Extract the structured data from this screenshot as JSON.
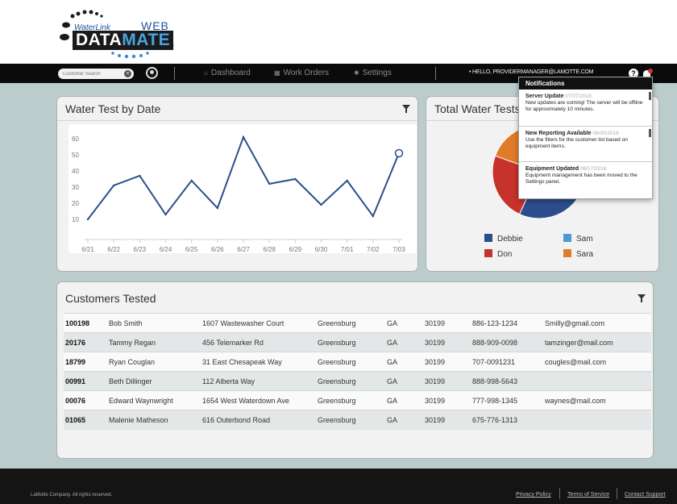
{
  "brand": {
    "top": "WaterLink",
    "web": "WEB",
    "name_a": "DATA",
    "name_b": "MATE"
  },
  "nav": {
    "search_placeholder": "Customer Search",
    "dashboard": "Dashboard",
    "work_orders": "Work Orders",
    "settings": "Settings",
    "hello": "• HELLO, PROVIDERMANAGER@LAMOTTE.COM",
    "help": "?"
  },
  "notifications": {
    "title": "Notifications",
    "items": [
      {
        "title": "Server Update",
        "date": "07/07/2016",
        "body": "New updates are coming! The server will be offline for approximately 10 minutes."
      },
      {
        "title": "New Reporting Available",
        "date": "06/30/2016",
        "body": "Use the filters for the customer list based on equipment items."
      },
      {
        "title": "Equipment Updated",
        "date": "06/17/2016",
        "body": "Equipment management has been moved to the Settings panel."
      }
    ]
  },
  "water_test": {
    "title": "Water Test by Date"
  },
  "chart_data": [
    {
      "type": "line",
      "title": "Water Test by Date",
      "categories": [
        "6/21",
        "6/22",
        "6/23",
        "6/24",
        "6/25",
        "6/26",
        "6/27",
        "6/28",
        "6/29",
        "6/30",
        "7/01",
        "7/02",
        "7/03"
      ],
      "values": [
        10,
        31,
        37,
        13,
        34,
        17,
        61,
        32,
        35,
        19,
        34,
        12,
        51
      ],
      "yticks": [
        10,
        20,
        30,
        40,
        50,
        60
      ],
      "ylim": [
        0,
        65
      ],
      "line_color": "#2b4f8a"
    },
    {
      "type": "pie",
      "title": "Total Water Tests",
      "legend": [
        {
          "name": "Debbie",
          "color": "#2c4d8c"
        },
        {
          "name": "Sam",
          "color": "#4a9bd4"
        },
        {
          "name": "Don",
          "color": "#c8322c"
        },
        {
          "name": "Sara",
          "color": "#e07b2a"
        }
      ]
    }
  ],
  "customers": {
    "title": "Customers Tested",
    "rows": [
      {
        "id": "100198",
        "name": "Bob Smith",
        "address": "1607 Wastewasher Court",
        "city": "Greensburg",
        "state": "GA",
        "zip": "30199",
        "phone": "886-123-1234",
        "email": "Smilly@gmail.com"
      },
      {
        "id": "20176",
        "name": "Tammy Regan",
        "address": "456 Telemarker Rd",
        "city": "Greensburg",
        "state": "GA",
        "zip": "30199",
        "phone": "888-909-0098",
        "email": "tamzinger@mail.com"
      },
      {
        "id": "18799",
        "name": "Ryan Couglan",
        "address": "31 East Chesapeak Way",
        "city": "Greensburg",
        "state": "GA",
        "zip": "30199",
        "phone": "707-0091231",
        "email": "cougles@mail.com"
      },
      {
        "id": "00991",
        "name": "Beth Dillinger",
        "address": "112 Alberta Way",
        "city": "Greensburg",
        "state": "GA",
        "zip": "30199",
        "phone": "888-998-5643",
        "email": ""
      },
      {
        "id": "00076",
        "name": "Edward Waynwright",
        "address": "1654 West Waterdown Ave",
        "city": "Greensburg",
        "state": "GA",
        "zip": "30199",
        "phone": "777-998-1345",
        "email": "waynes@mail.com"
      },
      {
        "id": "01065",
        "name": "Malenie Matheson",
        "address": "616 Outerbond Road",
        "city": "Greensburg",
        "state": "GA",
        "zip": "30199",
        "phone": "675-776-1313",
        "email": ""
      }
    ]
  },
  "footer": {
    "copyright": "LaMotte Company. All rights reserved.",
    "privacy": "Privacy Policy",
    "terms": "Terms of Service",
    "contact": "Contact Support"
  }
}
